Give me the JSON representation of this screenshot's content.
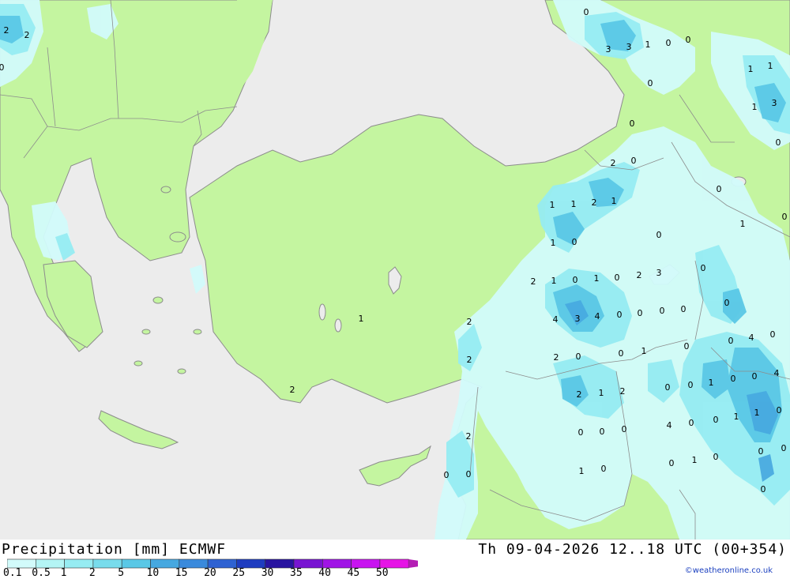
{
  "title": "Precipitation [mm] ECMWF",
  "datetime": "Th 09-04-2026 12..18 UTC (00+354)",
  "credit": "©weatheronline.co.uk",
  "legend": {
    "labels": [
      "0.1",
      "0.5",
      "1",
      "2",
      "5",
      "10",
      "15",
      "20",
      "25",
      "30",
      "35",
      "40",
      "45",
      "50"
    ],
    "colors": [
      "#d2fbfb",
      "#b4f5f5",
      "#96ecf2",
      "#78dcec",
      "#5ac8e6",
      "#46a8e0",
      "#3a8adc",
      "#2e62d2",
      "#1e3cc0",
      "#2814a0",
      "#7814d2",
      "#a014e6",
      "#c814f0",
      "#e614e6",
      "#b41eb4"
    ]
  },
  "map": {
    "colors": {
      "sea": "#ececec",
      "land": "#c4f5a0",
      "border": "#8c8c8c",
      "p1": "#d2fbfb",
      "p2": "#96ecf2",
      "p3": "#5ac8e6",
      "p4": "#46a8e0"
    },
    "values": [
      "2",
      "2",
      "0",
      "0",
      "3",
      "3",
      "1",
      "0",
      "0",
      "0",
      "1",
      "1",
      "3",
      "1",
      "0",
      "0",
      "2",
      "0",
      "1",
      "1",
      "2",
      "1",
      "0",
      "1",
      "0",
      "1",
      "0",
      "0",
      "0",
      "2",
      "1",
      "0",
      "0",
      "4",
      "3",
      "4",
      "0",
      "0",
      "0",
      "0",
      "0",
      "1",
      "2",
      "4",
      "0",
      "3",
      "0",
      "1",
      "2",
      "0",
      "2",
      "0",
      "4",
      "1",
      "2",
      "0",
      "0",
      "0",
      "1",
      "0",
      "0",
      "2",
      "1",
      "2",
      "1",
      "0",
      "1",
      "0",
      "0",
      "4",
      "2",
      "0",
      "0",
      "0",
      "0",
      "0",
      "2",
      "0",
      "1",
      "0",
      "0",
      "1",
      "0",
      "0",
      "0"
    ]
  }
}
